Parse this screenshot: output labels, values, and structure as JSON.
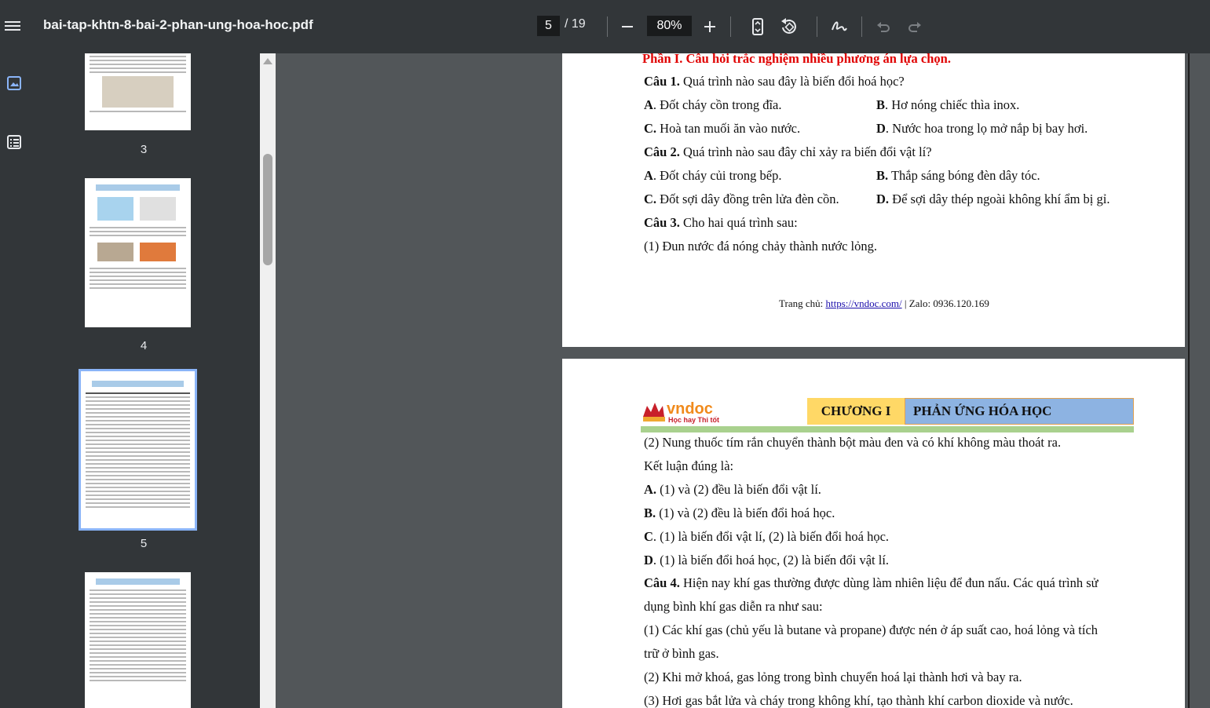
{
  "toolbar": {
    "title": "bai-tap-khtn-8-bai-2-phan-ung-hoa-hoc.pdf",
    "page_current": "5",
    "page_total": "/ 19",
    "zoom": "80%"
  },
  "thumbnails": [
    {
      "label": "3"
    },
    {
      "label": "4"
    },
    {
      "label": "5"
    },
    {
      "label": ""
    }
  ],
  "page_a": {
    "section_heading": "Phần I. Câu hỏi trắc nghiệm nhiều phương án lựa chọn.",
    "q1_num": "Câu 1.",
    "q1_text": " Quá trình nào sau đây là biến đổi hoá học?",
    "q1_a_letter": "A",
    "q1_a": ". Đốt cháy cồn trong đĩa.",
    "q1_b_letter": "B",
    "q1_b": ". Hơ nóng chiếc thìa inox.",
    "q1_c_letter": "C.",
    "q1_c": " Hoà tan muối ăn vào nước.",
    "q1_d_letter": "D",
    "q1_d": ". Nước hoa trong lọ mở nắp bị bay hơi.",
    "q2_num": "Câu 2.",
    "q2_text": " Quá trình nào sau đây chỉ xảy ra biến đổi vật lí?",
    "q2_a_letter": "A",
    "q2_a": ". Đốt cháy củi trong bếp.",
    "q2_b_letter": "B.",
    "q2_b": " Thắp sáng bóng đèn dây tóc.",
    "q2_c_letter": "C.",
    "q2_c": " Đốt sợi dây đồng trên lửa đèn cồn.",
    "q2_d_letter": "D.",
    "q2_d": " Để sợi dây thép ngoài không khí ẩm bị gỉ.",
    "q3_num": "Câu 3.",
    "q3_text": " Cho hai quá trình sau:",
    "q3_item1": "(1) Đun nước đá nóng chảy thành nước lỏng.",
    "footer_prefix": "Trang chủ: ",
    "footer_link": "https://vndoc.com/",
    "footer_suffix": " | Zalo: 0936.120.169"
  },
  "page_b": {
    "logo_text": "vndoc",
    "logo_tagline": "Học hay Thi tốt",
    "chapter": "CHƯƠNG I",
    "chapter_title": "PHẢN ỨNG HÓA HỌC",
    "q3_item2": "(2) Nung thuốc tím rắn chuyển thành bột màu đen và có khí không màu thoát ra.",
    "q3_conclusion": "Kết luận đúng là:",
    "q3_a_letter": "A.",
    "q3_a": " (1) và (2) đều là biến đổi vật lí.",
    "q3_b_letter": "B.",
    "q3_b": " (1) và (2) đều là biến đổi hoá học.",
    "q3_c_letter": "C",
    "q3_c": ". (1) là biến đổi vật lí, (2) là biến đổi hoá học.",
    "q3_d_letter": "D",
    "q3_d": ". (1) là biến đổi hoá học, (2) là biến đổi vật lí.",
    "q4_num": "Câu 4.",
    "q4_text_1": " Hiện nay khí gas thường được dùng làm nhiên liệu để đun nấu. Các quá trình sử",
    "q4_text_2": "dụng bình khí gas diễn ra như sau:",
    "q4_item1_1": "(1) Các khí gas (chủ yếu là butane và propane) được nén ở áp suất cao, hoá lỏng và tích",
    "q4_item1_2": "trữ ở bình gas.",
    "q4_item2": "(2) Khi mở khoá, gas lỏng trong bình chuyển hoá lại thành hơi và bay ra.",
    "q4_item3": "(3) Hơi gas bắt lửa và cháy trong không khí, tạo thành khí carbon dioxide và nước."
  }
}
